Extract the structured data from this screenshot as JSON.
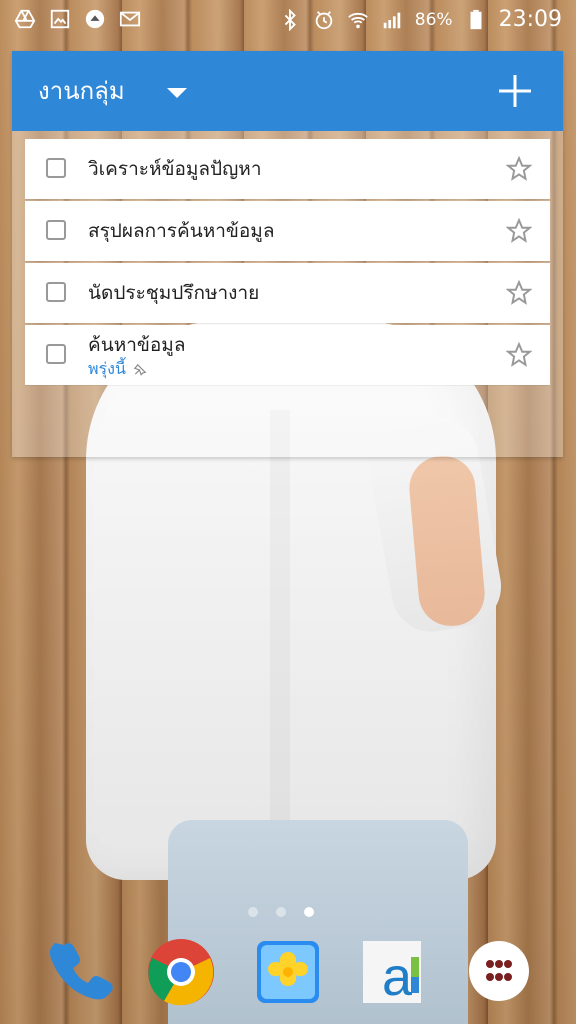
{
  "status_bar": {
    "battery_text": "86%",
    "time": "23:09",
    "left_icons": [
      "drive-icon",
      "image-icon",
      "upload-icon",
      "mail-icon"
    ],
    "right_icons": [
      "bluetooth-icon",
      "alarm-icon",
      "wifi-icon",
      "signal-icon",
      "battery-icon"
    ]
  },
  "widget": {
    "title": "งานกลุ่ม",
    "accent_color": "#2f87d8",
    "tasks": [
      {
        "label": "วิเคราะห์ข้อมูลปัญหา",
        "due": "",
        "checked": false,
        "starred": false
      },
      {
        "label": "สรุปผลการค้นหาข้อมูล",
        "due": "",
        "checked": false,
        "starred": false
      },
      {
        "label": "นัดประชุมปรึกษางาย",
        "due": "",
        "checked": false,
        "starred": false
      },
      {
        "label": "ค้นหาข้อมูล",
        "due": "พรุ่งนี้",
        "checked": false,
        "starred": false
      }
    ]
  },
  "home": {
    "page_count": 3,
    "current_page": 3,
    "dock_apps": [
      "phone-app",
      "chrome-app",
      "gallery-app",
      "a-app",
      "apps-button"
    ]
  }
}
